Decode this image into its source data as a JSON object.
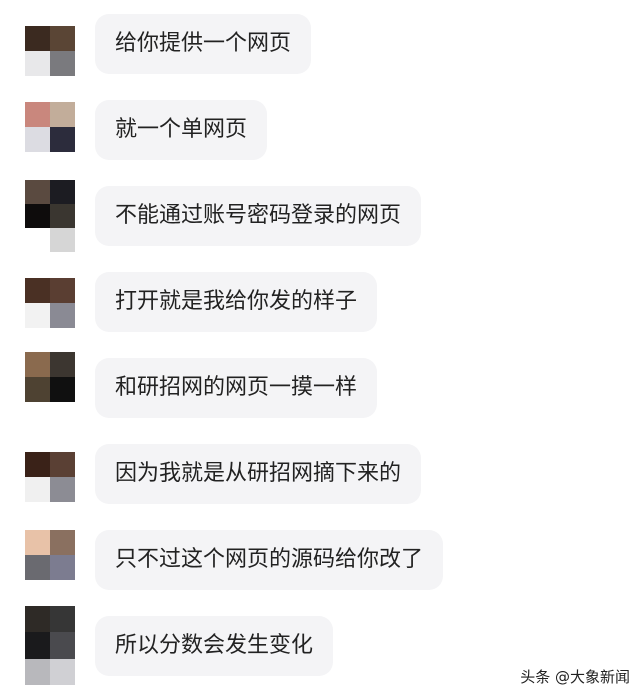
{
  "messages": [
    {
      "text": "给你提供一个网页",
      "avatar_colors": [
        "#3b2a20",
        "#5a4535",
        "#e8e8ea",
        "#7a7a7e"
      ]
    },
    {
      "text": "就一个单网页",
      "avatar_colors": [
        "#c9877d",
        "#c2ad9a",
        "#dcdce2",
        "#2c2c3c"
      ]
    },
    {
      "text": "不能通过账号密码登录的网页",
      "avatar_colors": [
        "#5a4a40",
        "#1c1c22",
        "#0e0c0c",
        "#3a3630",
        "#ffffff",
        "#d6d6d6"
      ]
    },
    {
      "text": "打开就是我给你发的样子",
      "avatar_colors": [
        "#4a3024",
        "#5a3e32",
        "#f2f2f2",
        "#8a8a94"
      ]
    },
    {
      "text": "和研招网的网页一摸一样",
      "avatar_colors": [
        "#8a6a4e",
        "#3c3630",
        "#4e4232",
        "#101010"
      ]
    },
    {
      "text": "因为我就是从研招网摘下来的",
      "avatar_colors": [
        "#3a2218",
        "#5a4034",
        "#f0f0f0",
        "#8c8c94"
      ]
    },
    {
      "text": "只不过这个网页的源码给你改了",
      "avatar_colors": [
        "#e8c2a8",
        "#8a7060",
        "#6a6a70",
        "#7c7c90"
      ]
    },
    {
      "text": "所以分数会发生变化",
      "avatar_colors": [
        "#2e2a26",
        "#363636",
        "#1a1a1c",
        "#4a4a4e",
        "#b8b8bc",
        "#d0d0d4"
      ]
    }
  ],
  "watermark": "头条 @大象新闻"
}
